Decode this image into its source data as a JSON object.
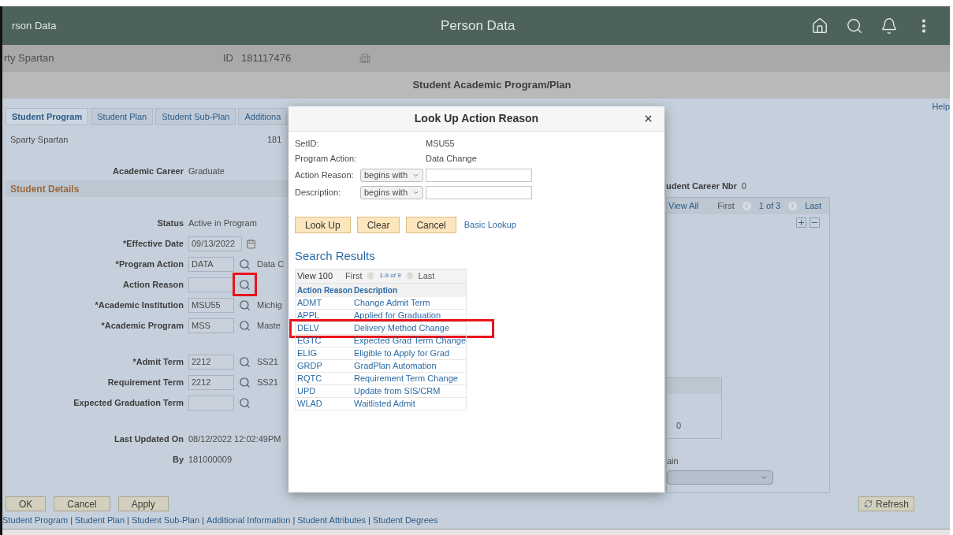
{
  "header": {
    "app_title": "rson Data",
    "title": "Person Data"
  },
  "person": {
    "name": "rty Spartan",
    "id_label": "ID",
    "id": "181117476"
  },
  "page_title": "Student Academic Program/Plan",
  "help": "Help",
  "tabs": [
    {
      "label": "Student Program",
      "selected": true
    },
    {
      "label": "Student Plan",
      "selected": false
    },
    {
      "label": "Student Sub-Plan",
      "selected": false
    },
    {
      "label": "Additiona",
      "selected": false
    }
  ],
  "student_name": "Sparty Spartan",
  "student_id": "181",
  "career": {
    "label": "Academic Career",
    "value": "Graduate"
  },
  "career_nbr": {
    "label": "udent Career Nbr",
    "value": "0"
  },
  "section_title": "Student Details",
  "nav": {
    "view_all": "View All",
    "first": "First",
    "count": "1 of 3",
    "last": "Last"
  },
  "field_groups": [
    [
      {
        "kind": "text",
        "label": "Status",
        "value": "Active in Program"
      },
      {
        "kind": "date",
        "label": "*Effective Date",
        "value": "09/13/2022"
      },
      {
        "kind": "lookup",
        "label": "*Program Action",
        "value": "DATA",
        "description": "Data C",
        "highlighted": false
      },
      {
        "kind": "lookup",
        "label": "Action Reason",
        "highlighted": true
      },
      {
        "kind": "lookup",
        "label": "*Academic Institution",
        "value": "MSU55",
        "description": "Michig",
        "highlighted": false
      },
      {
        "kind": "lookup",
        "label": "*Academic Program",
        "value": "MSS",
        "description": "Maste",
        "highlighted": false
      }
    ],
    [
      {
        "kind": "lookup",
        "label": "*Admit Term",
        "value": "2212",
        "description": "SS21",
        "highlighted": false
      },
      {
        "kind": "lookup",
        "label": "Requirement Term",
        "value": "2212",
        "description": "SS21",
        "highlighted": false
      },
      {
        "kind": "lookup",
        "label": "Expected Graduation Term",
        "highlighted": false
      }
    ],
    [
      {
        "kind": "text",
        "label": "Last Updated On",
        "value": "08/12/2022 12:02:49PM"
      },
      {
        "kind": "text",
        "label": "By",
        "value": "181000009"
      }
    ]
  ],
  "right_panel": {
    "sub_value": "0",
    "select_label": "ain"
  },
  "buttons": [
    "OK",
    "Cancel",
    "Apply"
  ],
  "refresh": "Refresh",
  "link_separator": "|",
  "links": [
    "Student Program",
    "Student Plan",
    "Student Sub-Plan",
    "Additional Information",
    "Student Attributes",
    "Student Degrees"
  ],
  "modal": {
    "title": "Look Up Action Reason",
    "info": [
      {
        "label": "SetID:",
        "value": "MSU55"
      },
      {
        "label": "Program Action:",
        "value": "Data Change"
      }
    ],
    "criteria": [
      {
        "label": "Action Reason:",
        "operator": "begins with"
      },
      {
        "label": "Description:",
        "operator": "begins with"
      }
    ],
    "buttons": [
      "Look Up",
      "Clear",
      "Cancel"
    ],
    "link": "Basic Lookup",
    "results_title": "Search Results",
    "pager": {
      "view": "View 100",
      "first": "First",
      "range": "1-9 of 9",
      "last": "Last"
    },
    "columns": [
      "Action Reason",
      "Description"
    ],
    "rows": [
      {
        "code": "ADMT",
        "description": "Change Admit Term",
        "highlighted": false
      },
      {
        "code": "APPL",
        "description": "Applied for Graduation",
        "highlighted": false
      },
      {
        "code": "DELV",
        "description": "Delivery Method Change",
        "highlighted": true
      },
      {
        "code": "EGTC",
        "description": "Expected Grad Term Change",
        "highlighted": false
      },
      {
        "code": "ELIG",
        "description": "Eligible to Apply for Grad",
        "highlighted": false
      },
      {
        "code": "GRDP",
        "description": "GradPlan Automation",
        "highlighted": false
      },
      {
        "code": "RQTC",
        "description": "Requirement Term Change",
        "highlighted": false
      },
      {
        "code": "UPD",
        "description": "Update from SIS/CRM",
        "highlighted": false
      },
      {
        "code": "WLAD",
        "description": "Waitlisted Admit",
        "highlighted": false
      }
    ]
  }
}
